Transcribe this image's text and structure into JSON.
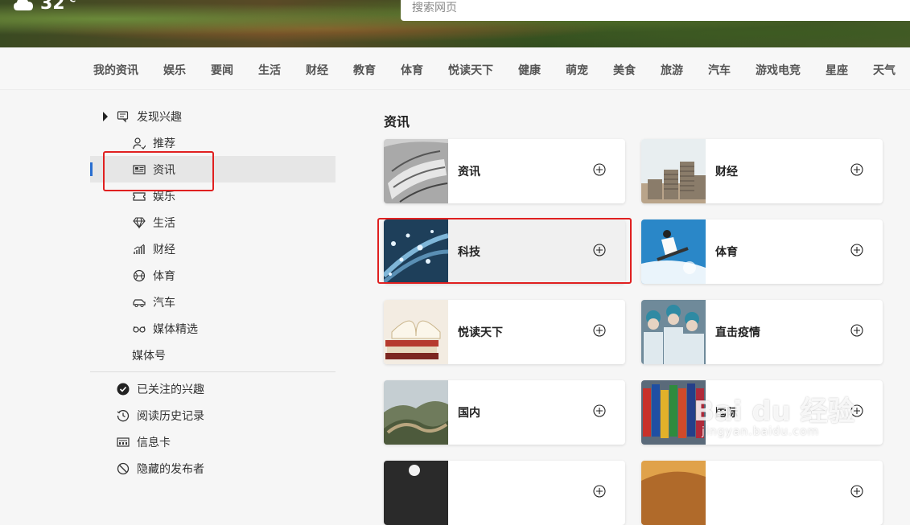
{
  "weather": {
    "temp": "32",
    "unit": "°C",
    "icon": "cloud-icon"
  },
  "search": {
    "placeholder": "搜索网页"
  },
  "categories": [
    "我的资讯",
    "娱乐",
    "要闻",
    "生活",
    "财经",
    "教育",
    "体育",
    "悦读天下",
    "健康",
    "萌宠",
    "美食",
    "旅游",
    "汽车",
    "游戏电竞",
    "星座",
    "天气"
  ],
  "sidebar": {
    "header": "发现兴趣",
    "items": [
      {
        "label": "推荐",
        "icon": "user-icon"
      },
      {
        "label": "资讯",
        "icon": "newspaper-icon",
        "active": true
      },
      {
        "label": "娱乐",
        "icon": "ticket-icon"
      },
      {
        "label": "生活",
        "icon": "diamond-icon"
      },
      {
        "label": "财经",
        "icon": "chart-icon"
      },
      {
        "label": "体育",
        "icon": "ball-icon"
      },
      {
        "label": "汽车",
        "icon": "car-icon"
      },
      {
        "label": "媒体精选",
        "icon": "glasses-icon"
      },
      {
        "label": "媒体号",
        "icon": ""
      }
    ],
    "bottom": [
      {
        "label": "已关注的兴趣",
        "icon": "check-circle-icon"
      },
      {
        "label": "阅读历史记录",
        "icon": "history-icon"
      },
      {
        "label": "信息卡",
        "icon": "card-icon"
      },
      {
        "label": "隐藏的发布者",
        "icon": "block-icon"
      }
    ]
  },
  "main": {
    "title": "资讯",
    "cards": [
      {
        "label": "资讯"
      },
      {
        "label": "财经"
      },
      {
        "label": "科技"
      },
      {
        "label": "体育"
      },
      {
        "label": "悦读天下"
      },
      {
        "label": "直击疫情"
      },
      {
        "label": "国内"
      },
      {
        "label": "国际"
      },
      {
        "label": ""
      },
      {
        "label": ""
      }
    ]
  },
  "watermark": {
    "main": "Bai du 经验",
    "sub": "jingyan.baidu.com"
  },
  "colors": {
    "accent": "#2a6ed0",
    "highlight": "#e02020"
  }
}
